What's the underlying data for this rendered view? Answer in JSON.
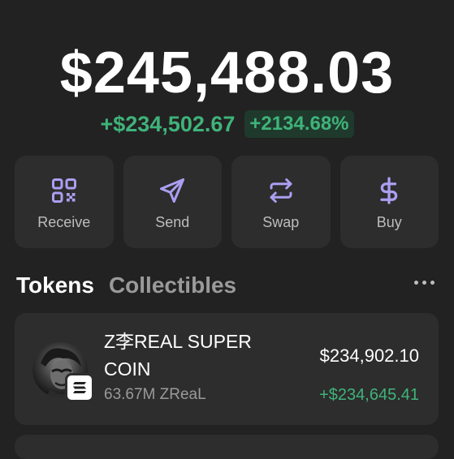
{
  "wallet": {
    "balance": "$245,488.03",
    "change_amount": "+$234,502.67",
    "change_percent": "+2134.68%"
  },
  "actions": [
    {
      "label": "Receive",
      "icon": "qr-code-icon"
    },
    {
      "label": "Send",
      "icon": "send-arrow-icon"
    },
    {
      "label": "Swap",
      "icon": "swap-arrows-icon"
    },
    {
      "label": "Buy",
      "icon": "dollar-icon"
    }
  ],
  "tabs": {
    "tokens": "Tokens",
    "collectibles": "Collectibles",
    "active": "Tokens"
  },
  "tokens": [
    {
      "name": "Z李REAL SUPER COIN",
      "amount": "63.67M ZReaL",
      "value": "$234,902.10",
      "pnl": "+$234,645.41",
      "chain_icon": "solana-icon"
    }
  ],
  "colors": {
    "background": "#222222",
    "card": "#2d2d2d",
    "accent": "#ab9ff2",
    "positive": "#3fb37a"
  }
}
